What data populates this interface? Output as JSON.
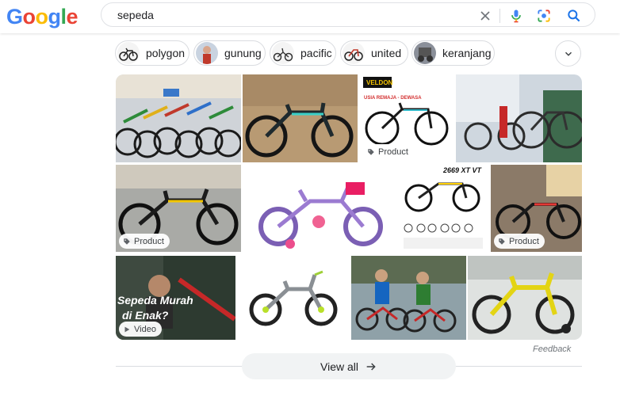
{
  "logo": {
    "text": "Google",
    "letters": [
      "G",
      "o",
      "o",
      "g",
      "l",
      "e"
    ],
    "colors": [
      "#4285F4",
      "#EA4335",
      "#FBBC05",
      "#4285F4",
      "#34A853",
      "#EA4335"
    ]
  },
  "search": {
    "query": "sepeda"
  },
  "icons": {
    "clear": "close-icon",
    "mic": "microphone-icon",
    "lens": "camera-lens-icon",
    "search": "search-icon"
  },
  "chips": [
    {
      "label": "polygon"
    },
    {
      "label": "gunung"
    },
    {
      "label": "pacific"
    },
    {
      "label": "united"
    },
    {
      "label": "keranjang"
    }
  ],
  "badges": {
    "product": "Product",
    "video": "Video"
  },
  "tiles": {
    "t1_banner": "VELDON",
    "t1_sub": "USIA REMAJA - DEWASA",
    "t4_label": "2669 XT VT",
    "t6_text1": "Sepeda Murah",
    "t6_text2": "di Enak?"
  },
  "feedback": "Feedback",
  "view_all": "View all",
  "colors": {
    "accent_blue": "#1a73e8",
    "chip_border": "#dadce0"
  }
}
